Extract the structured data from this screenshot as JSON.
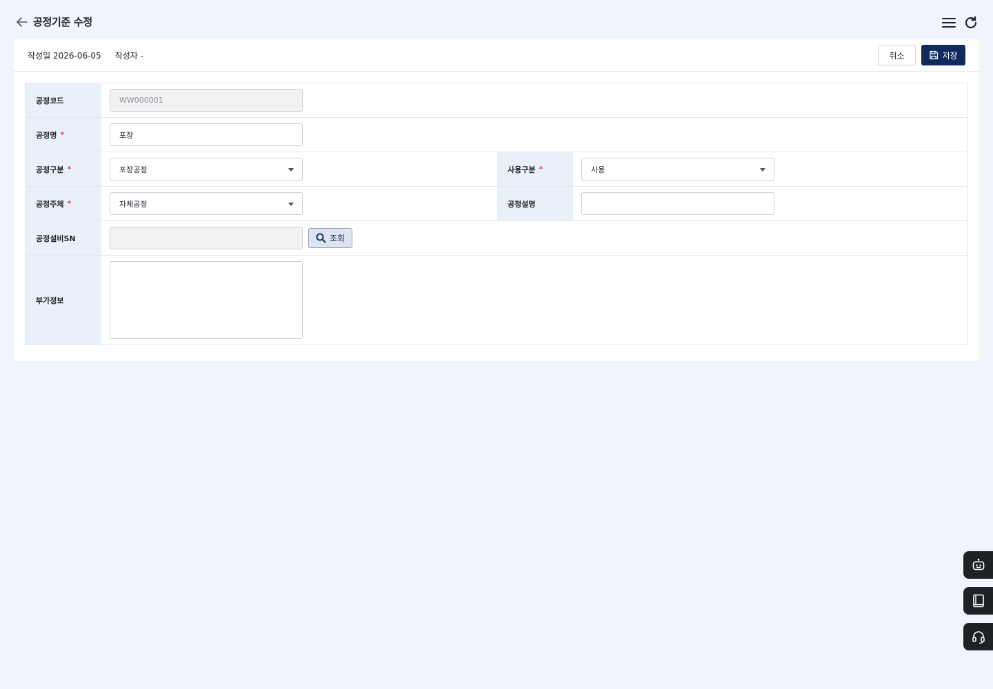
{
  "header": {
    "title": "공정기준 수정",
    "icons": {
      "back": "arrow-left-icon",
      "menu": "hamburger-icon",
      "refresh": "refresh-icon"
    }
  },
  "meta": {
    "created_label": "작성일",
    "created_value": "2026-06-05",
    "author_label": "작성자",
    "author_value": "-"
  },
  "actions": {
    "cancel_label": "취소",
    "save_label": "저장"
  },
  "form": {
    "process_code": {
      "label": "공정코드",
      "value": "WW000001"
    },
    "process_name": {
      "label": "공정명",
      "value": "포장"
    },
    "process_type": {
      "label": "공정구분",
      "value": "포장공정"
    },
    "use_type": {
      "label": "사용구분",
      "value": "사용"
    },
    "process_owner": {
      "label": "공정주체",
      "value": "자체공정"
    },
    "process_desc": {
      "label": "공정설명",
      "value": ""
    },
    "equipment_sn": {
      "label": "공정설비SN",
      "value": "",
      "search_label": "조회"
    },
    "extra_info": {
      "label": "부가정보",
      "value": ""
    },
    "required_mark": "*"
  },
  "side_buttons": [
    "chatbot-icon",
    "manual-book-icon",
    "headset-support-icon"
  ],
  "colors": {
    "primary": "#0f2a5c",
    "label_bg": "#eaf0fa",
    "required": "#e5484d",
    "page_bg": "#f1f4fb"
  }
}
